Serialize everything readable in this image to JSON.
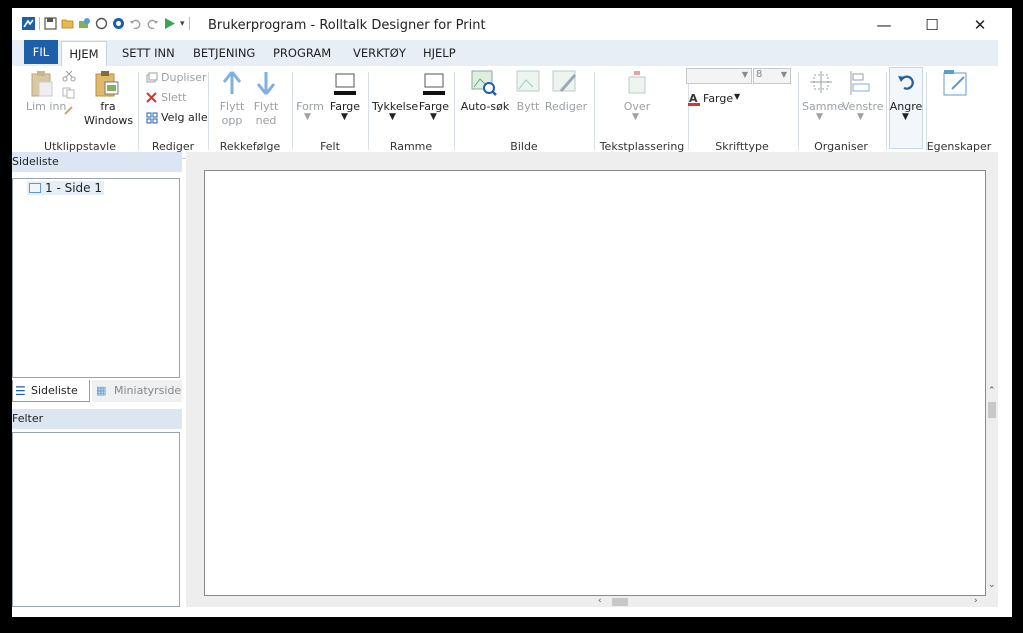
{
  "window": {
    "title": "Brukerprogram - Rolltalk Designer for Print",
    "controls": {
      "minimize": "—",
      "maximize": "☐",
      "close": "✕"
    }
  },
  "quick_access": {
    "icons": [
      "app-icon",
      "save-icon",
      "open-icon",
      "template-icon",
      "circle-icon",
      "record-icon",
      "undo-icon",
      "redo-icon",
      "play-icon",
      "customize-icon"
    ]
  },
  "tabs": {
    "fil": "FIL",
    "hjem": "HJEM",
    "sett_inn": "SETT INN",
    "betjening": "BETJENING",
    "program": "PROGRAM",
    "verktoy": "VERKTØY",
    "hjelp": "HJELP"
  },
  "ribbon": {
    "utklippstavle": {
      "label": "Utklippstavle",
      "lim_inn": "Lim inn",
      "fra_windows": "fra Windows"
    },
    "rediger": {
      "label": "Rediger",
      "dupliser": "Dupliser",
      "slett": "Slett",
      "velg_alle": "Velg alle"
    },
    "rekkefolge": {
      "label": "Rekkefølge",
      "flytt_opp": "Flytt opp",
      "flytt_ned": "Flytt ned"
    },
    "felt": {
      "label": "Felt",
      "form": "Form",
      "farge": "Farge"
    },
    "ramme": {
      "label": "Ramme",
      "tykkelse": "Tykkelse",
      "farge": "Farge"
    },
    "bilde": {
      "label": "Bilde",
      "auto_sok": "Auto-søk",
      "bytt": "Bytt",
      "rediger": "Rediger"
    },
    "tekstplassering": {
      "label": "Tekstplassering",
      "over": "Over"
    },
    "skrifttype": {
      "label": "Skrifttype",
      "font_name": "",
      "font_size": "8",
      "farge": "Farge"
    },
    "organiser": {
      "label": "Organiser",
      "samme": "Samme",
      "venstre": "Venstre"
    },
    "angre": {
      "angre": "Angre"
    },
    "egenskaper": {
      "label": "Egenskaper"
    }
  },
  "left_panel": {
    "sideliste_header": "Sideliste",
    "pages": [
      {
        "label": "1 - Side 1"
      }
    ],
    "tab_sideliste": "Sideliste",
    "tab_miniatyrsider": "Miniatyrsider",
    "felter_header": "Felter"
  },
  "colors": {
    "accent": "#1d5fa8",
    "tabbar_bg": "#e8eef6",
    "panel_header": "#dce6f2",
    "icon_blue": "#5b9bd5",
    "slett_red": "#d9342b",
    "font_color_bar": "#d9342b"
  }
}
